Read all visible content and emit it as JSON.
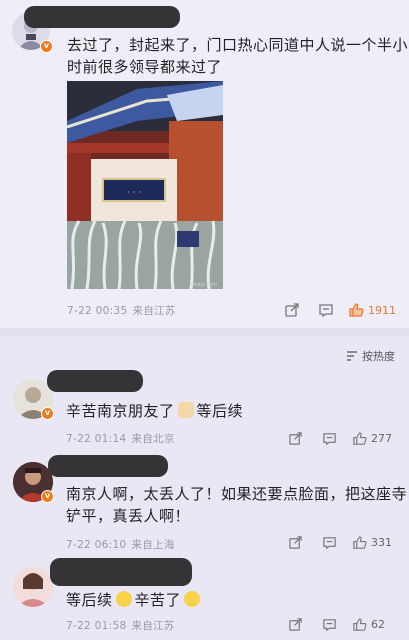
{
  "post": {
    "text_line1": "去过了，封起来了，门口热心同道中人说一个半小",
    "text_line2": "时前很多领导都来过了",
    "date": "7-22 00:35",
    "source": "来自江苏",
    "like_count": "1911"
  },
  "sort_label": "按热度",
  "comments": [
    {
      "text": "辛苦南京朋友了",
      "text_after": "等后续",
      "date": "7-22 01:14",
      "source": "来自北京",
      "like_count": "277"
    },
    {
      "text_line1": "南京人啊，太丢人了！如果还要点脸面，把这座寺",
      "text_line2": "铲平，真丢人啊！",
      "date": "7-22 06:10",
      "source": "来自上海",
      "like_count": "331"
    },
    {
      "text": "等后续",
      "text_after": "辛苦了",
      "date": "7-22 01:58",
      "source": "来自江苏",
      "like_count": "62"
    }
  ],
  "icons": {
    "share": "share-icon",
    "comment": "comment-icon",
    "like": "like-icon",
    "sort": "sort-icon"
  },
  "colors": {
    "accent": "#e8742a",
    "verified": "#f07b1e",
    "background": "#e9e7f4"
  }
}
